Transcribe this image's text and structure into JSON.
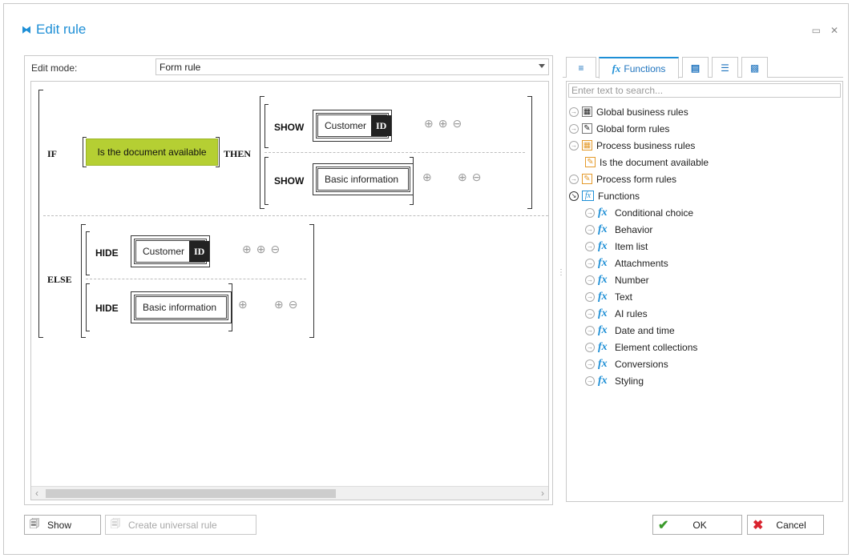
{
  "window": {
    "title": "Edit rule",
    "icon": "link-icon"
  },
  "editor": {
    "edit_mode_label": "Edit mode:",
    "edit_mode_value": "Form rule",
    "if_kw": "IF",
    "then_kw": "THEN",
    "else_kw": "ELSE",
    "condition": "Is the document available",
    "then_actions": [
      {
        "action": "SHOW",
        "field": "Customer",
        "badge": "ID"
      },
      {
        "action": "SHOW",
        "field": "Basic information"
      }
    ],
    "else_actions": [
      {
        "action": "HIDE",
        "field": "Customer",
        "badge": "ID"
      },
      {
        "action": "HIDE",
        "field": "Basic information"
      }
    ]
  },
  "panel": {
    "tabs": [
      {
        "icon": "variables-icon"
      },
      {
        "label": "Functions",
        "icon": "fx-icon"
      },
      {
        "icon": "form-field-icon"
      },
      {
        "icon": "list-icon"
      },
      {
        "icon": "bracket-icon"
      }
    ],
    "search_placeholder": "Enter text to search...",
    "tree": [
      {
        "label": "Global business rules",
        "icon": "business-rules-icon",
        "level": 0,
        "expanded": false
      },
      {
        "label": "Global form rules",
        "icon": "form-rules-icon",
        "level": 0,
        "expanded": false
      },
      {
        "label": "Process business rules",
        "icon": "process-rules-icon",
        "level": 0,
        "expanded": false
      },
      {
        "label": "Is the document available",
        "icon": "rule-icon",
        "level": 1
      },
      {
        "label": "Process form rules",
        "icon": "rule-icon",
        "level": 0,
        "expanded": false
      },
      {
        "label": "Functions",
        "icon": "functions-folder-icon",
        "level": 0,
        "expanded": true
      },
      {
        "label": "Conditional choice",
        "icon": "fx-icon",
        "level": 1
      },
      {
        "label": "Behavior",
        "icon": "fx-icon",
        "level": 1
      },
      {
        "label": "Item list",
        "icon": "fx-icon",
        "level": 1
      },
      {
        "label": "Attachments",
        "icon": "fx-icon",
        "level": 1
      },
      {
        "label": "Number",
        "icon": "fx-icon",
        "level": 1
      },
      {
        "label": "Text",
        "icon": "fx-icon",
        "level": 1
      },
      {
        "label": "AI rules",
        "icon": "fx-icon",
        "level": 1
      },
      {
        "label": "Date and time",
        "icon": "fx-icon",
        "level": 1
      },
      {
        "label": "Element collections",
        "icon": "fx-icon",
        "level": 1
      },
      {
        "label": "Conversions",
        "icon": "fx-icon",
        "level": 1
      },
      {
        "label": "Styling",
        "icon": "fx-icon",
        "level": 1
      }
    ]
  },
  "buttons": {
    "show": "Show",
    "create_universal": "Create universal rule",
    "ok": "OK",
    "cancel": "Cancel"
  },
  "colors": {
    "accent": "#1e8fd6",
    "condition_bg": "#b5cf33",
    "ok_icon": "#3a9a2a",
    "cancel_icon": "#d9232e"
  }
}
